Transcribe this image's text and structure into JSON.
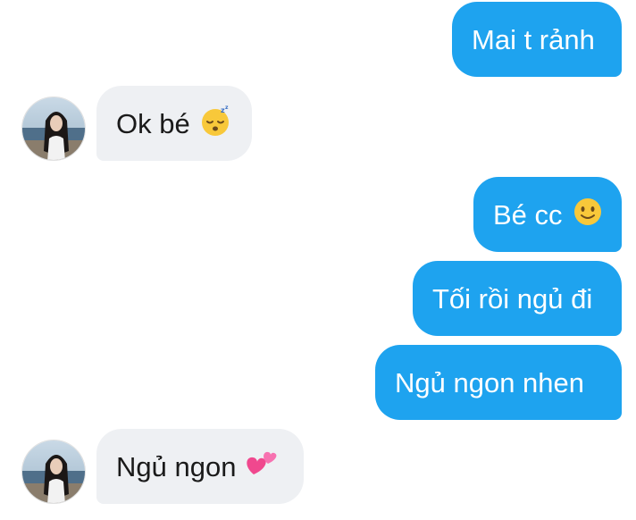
{
  "messages": [
    {
      "side": "out",
      "text": "Mai t rảnh",
      "emoji": ""
    },
    {
      "side": "in",
      "text": "Ok bé",
      "emoji": "sleeping-face-icon"
    },
    {
      "side": "out",
      "text": "Bé cc",
      "emoji": "slightly-smiling-face-icon"
    },
    {
      "side": "out",
      "text": "Tối rồi ngủ đi",
      "emoji": ""
    },
    {
      "side": "out",
      "text": "Ngủ ngon nhen",
      "emoji": ""
    },
    {
      "side": "in",
      "text": "Ngủ ngon",
      "emoji": "two-hearts-icon"
    }
  ],
  "colors": {
    "outgoing_bubble": "#1ea3ef",
    "incoming_bubble": "#eef0f3",
    "outgoing_text": "#ffffff",
    "incoming_text": "#1a1a1a"
  }
}
